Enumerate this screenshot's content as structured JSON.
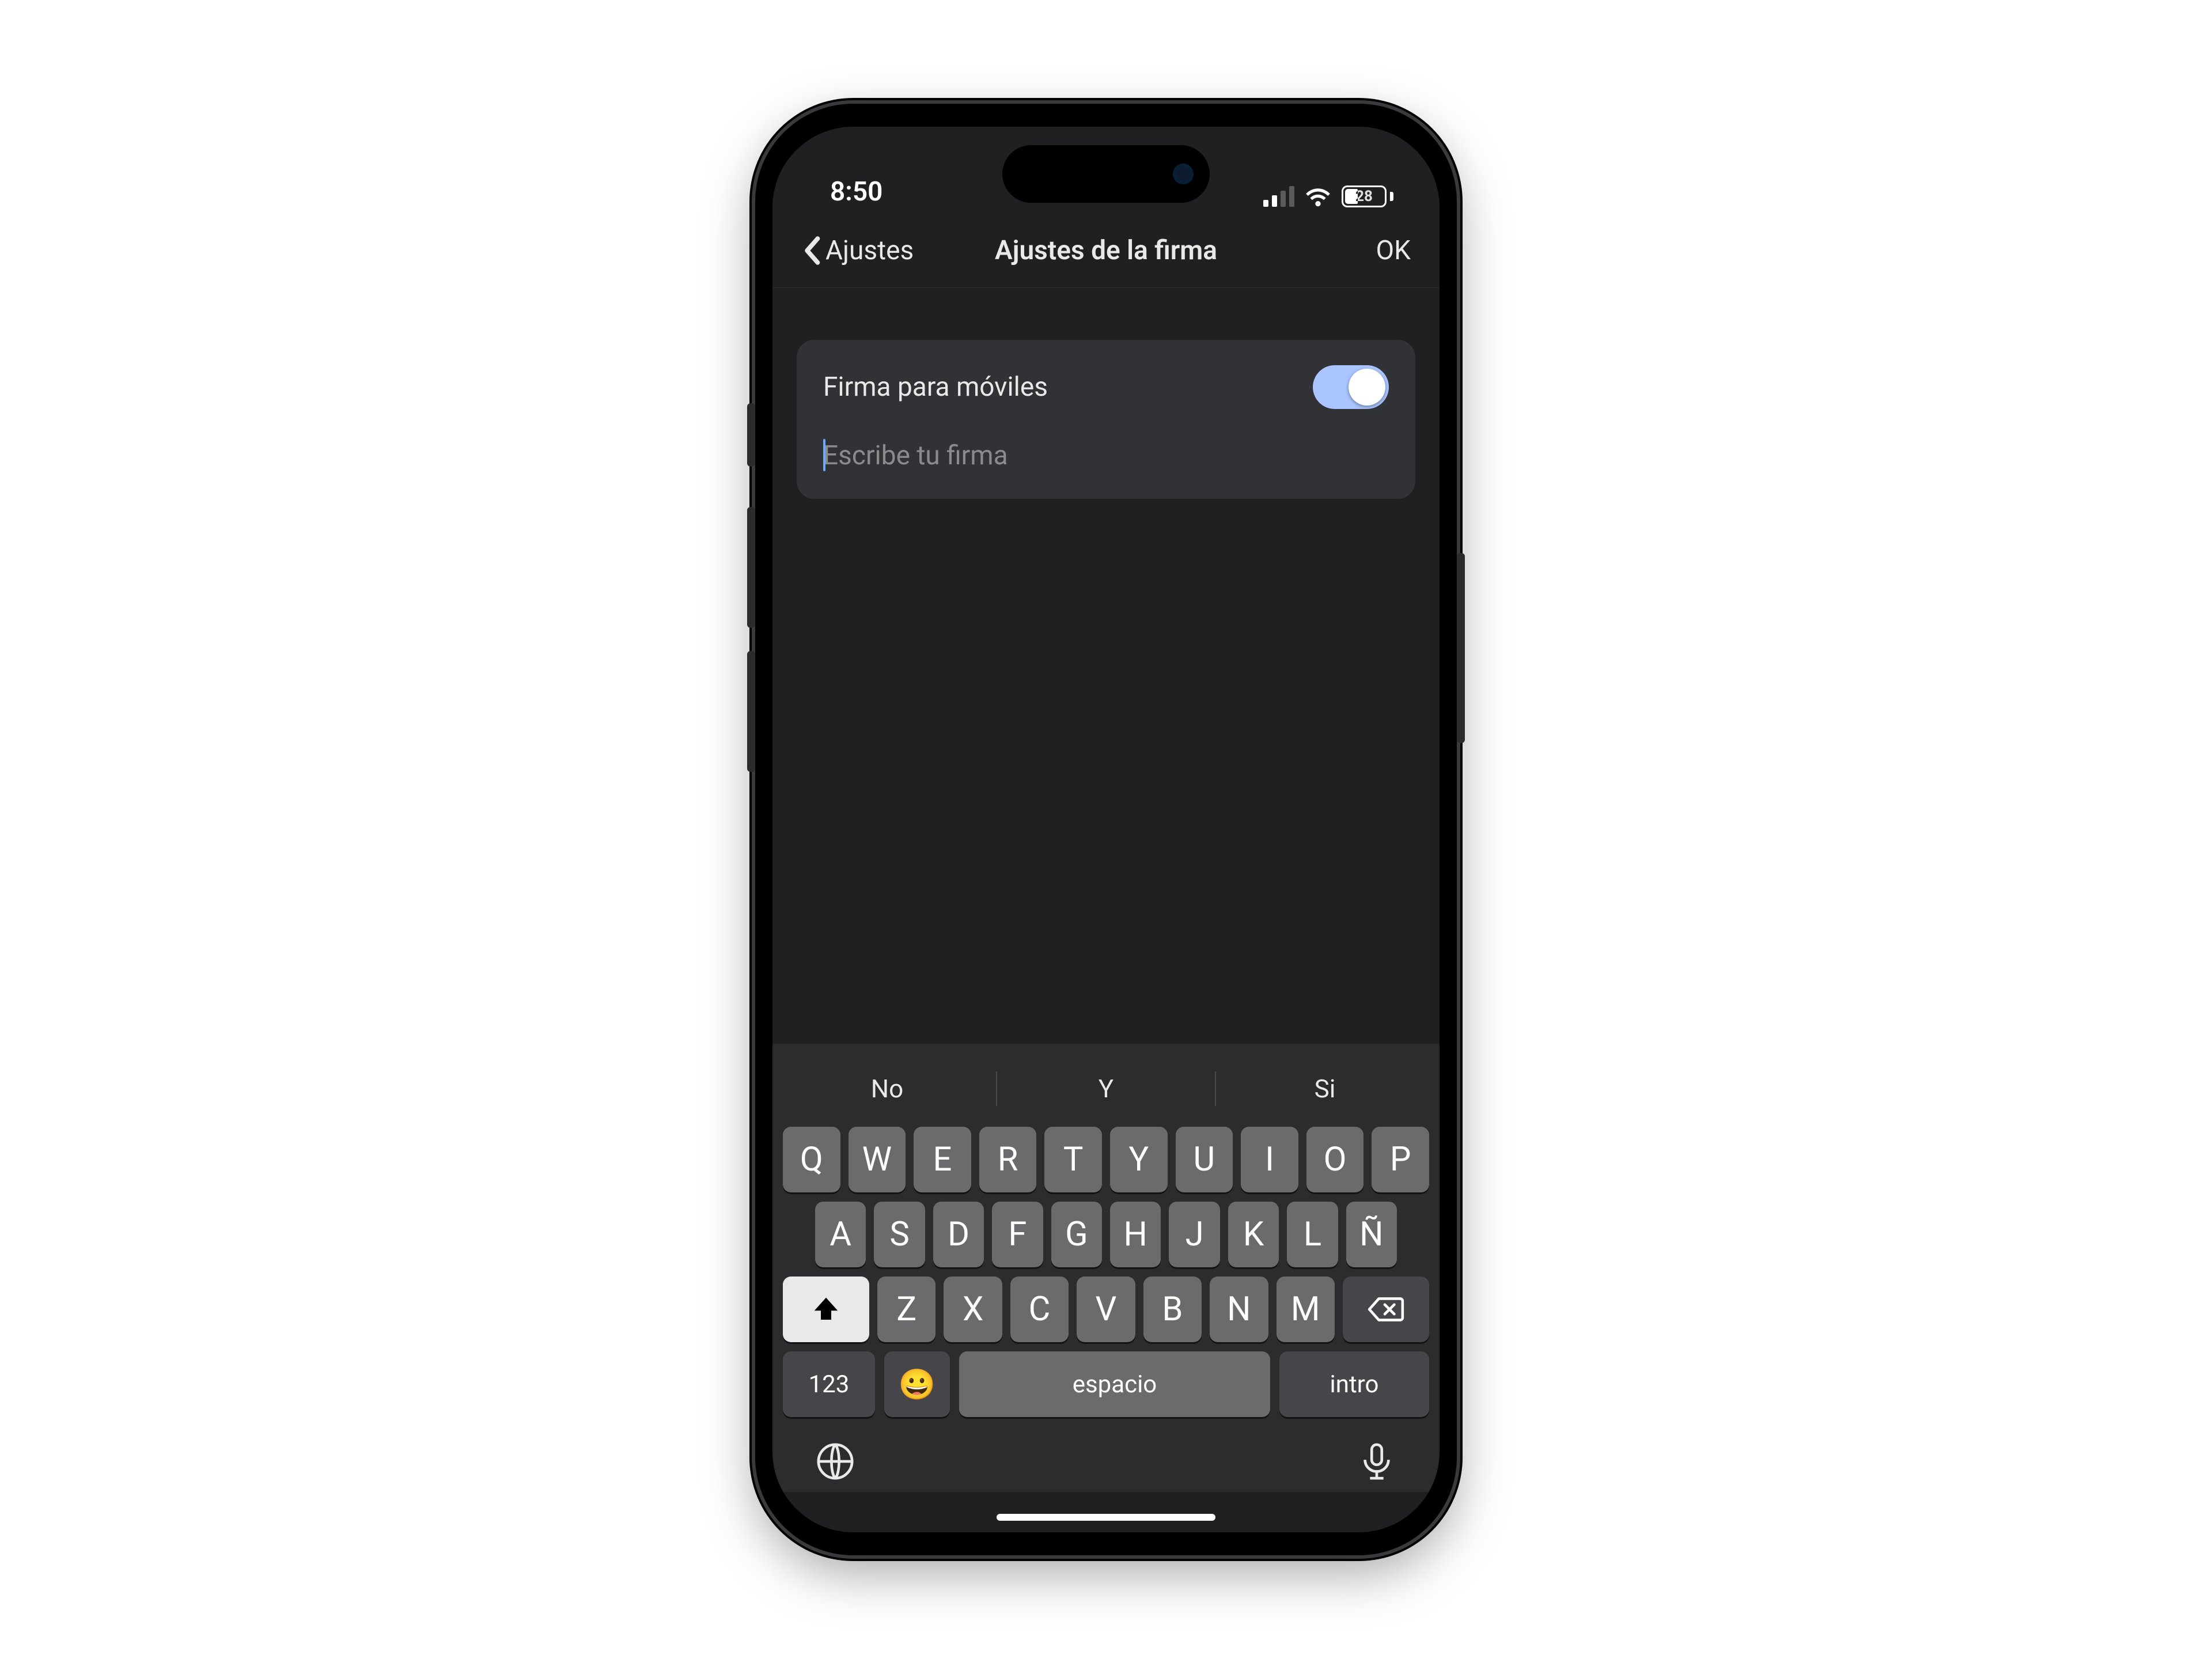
{
  "status": {
    "time": "8:50",
    "battery_pct": "28"
  },
  "nav": {
    "back_label": "Ajustes",
    "title": "Ajustes de la firma",
    "ok": "OK"
  },
  "card": {
    "toggle_label": "Firma para móviles",
    "toggle_on": true,
    "input_placeholder": "Escribe tu firma"
  },
  "keyboard": {
    "suggestions": [
      "No",
      "Y",
      "Si"
    ],
    "row1": [
      "Q",
      "W",
      "E",
      "R",
      "T",
      "Y",
      "U",
      "I",
      "O",
      "P"
    ],
    "row2": [
      "A",
      "S",
      "D",
      "F",
      "G",
      "H",
      "J",
      "K",
      "L",
      "Ñ"
    ],
    "row3": [
      "Z",
      "X",
      "C",
      "V",
      "B",
      "N",
      "M"
    ],
    "numbers_label": "123",
    "space_label": "espacio",
    "return_label": "intro"
  }
}
